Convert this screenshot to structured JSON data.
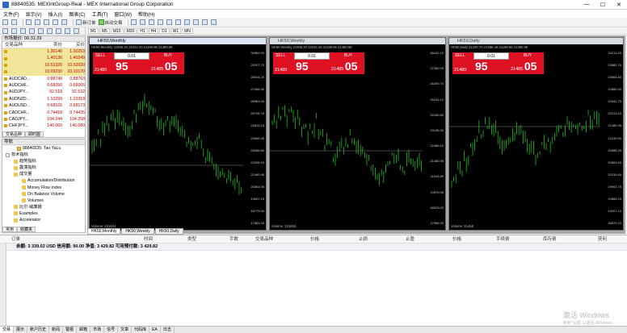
{
  "window": {
    "title": "88840535: MEXIntGroup-Real - MEX International Group Corporation",
    "min": "—",
    "max": "☐",
    "close": "✕"
  },
  "menu": [
    "文件(F)",
    "显示(V)",
    "插入(I)",
    "图表(C)",
    "工具(T)",
    "窗口(W)",
    "帮助(H)"
  ],
  "toolbar": {
    "new_order": "新订单",
    "auto_trade": "自动交易",
    "timeframes": [
      "M1",
      "M5",
      "M15",
      "M30",
      "H1",
      "H4",
      "D1",
      "W1",
      "MN"
    ]
  },
  "market_watch": {
    "header": "市场报价: 06:31:29",
    "cols": [
      "交易品种",
      "卖价",
      "买价"
    ],
    "rows": [
      {
        "sym": "",
        "bid": "1.30146",
        "ask": "1.30253",
        "hl": true
      },
      {
        "sym": "",
        "bid": "1.40136",
        "ask": "1.40249",
        "hl": true
      },
      {
        "sym": "",
        "bid": "10.51320",
        "ask": "10.52020",
        "hl": true
      },
      {
        "sym": "",
        "bid": "10.09230",
        "ask": "10.10170",
        "hl": true
      },
      {
        "sym": "AUDCAD...",
        "bid": "0.88748",
        "ask": "0.88763",
        "hl": false
      },
      {
        "sym": "AUDCHF...",
        "bid": "0.66050",
        "ask": "0.66065",
        "hl": false
      },
      {
        "sym": "AUDJPY...",
        "bid": "92.518",
        "ask": "92.532",
        "hl": false
      },
      {
        "sym": "AUDNZD...",
        "bid": "1.10299",
        "ask": "1.10318",
        "hl": false
      },
      {
        "sym": "AUDUSD...",
        "bid": "0.68165",
        "ask": "0.68173",
        "hl": false
      },
      {
        "sym": "CADCHF...",
        "bid": "0.74418",
        "ask": "0.74435",
        "hl": false
      },
      {
        "sym": "CADJPY...",
        "bid": "104.244",
        "ask": "104.258",
        "hl": false
      },
      {
        "sym": "CHFJPY...",
        "bid": "140.060",
        "ask": "140.080",
        "hl": false
      }
    ],
    "tabs": [
      "交易品种",
      "即时图"
    ]
  },
  "navigator": {
    "header": "导航",
    "items": [
      {
        "label": "88840535: Tao YaLu",
        "indent": 18,
        "kind": "pico"
      },
      {
        "label": "技术指标",
        "indent": 4,
        "kind": "box"
      },
      {
        "label": "趋势指标",
        "indent": 14,
        "kind": "fico"
      },
      {
        "label": "震荡指标",
        "indent": 14,
        "kind": "fico"
      },
      {
        "label": "成交量",
        "indent": 14,
        "kind": "fico"
      },
      {
        "label": "Accumulation/Distribution",
        "indent": 24,
        "kind": "fico"
      },
      {
        "label": "Money Flow Index",
        "indent": 24,
        "kind": "fico"
      },
      {
        "label": "On Balance Volume",
        "indent": 24,
        "kind": "fico"
      },
      {
        "label": "Volumes",
        "indent": 24,
        "kind": "fico"
      },
      {
        "label": "比尔·威廉姆",
        "indent": 14,
        "kind": "fico"
      },
      {
        "label": "Examples",
        "indent": 14,
        "kind": "fico"
      },
      {
        "label": "Accelerator",
        "indent": 14,
        "kind": "fico"
      }
    ],
    "tabs": [
      "常用",
      "收藏夹"
    ]
  },
  "charts": [
    {
      "id": "monthly",
      "title": "HK50,Monthly",
      "ohlc": "HK50,Monthly 21906.20 22224.40 21199.95 21480.95",
      "volume": "Volume: 231604",
      "sell_label": "SELL",
      "buy_label": "BUY",
      "lot": "0.01",
      "sell_px_small": "21480",
      "sell_px_big": "95",
      "buy_px_small": "21485",
      "buy_px_big": "05",
      "scale": [
        "30962.00",
        "29207.70",
        "28334.20",
        "27456.30",
        "26581.00",
        "25705.70",
        "24831.10",
        "23960.45",
        "23086.60",
        "22205.10",
        "21480.95",
        "20583.05",
        "19657.15",
        "18779.00",
        "17881.00"
      ],
      "current": "21480.95"
    },
    {
      "id": "weekly",
      "title": "HK50,Weekly",
      "ohlc": "HK50,Weekly 21906.20 22224.40 21199.95 21480.95",
      "volume": "Volume: 231653",
      "sell_label": "SELL",
      "buy_label": "BUY",
      "lot": "0.01",
      "sell_px_small": "21480",
      "sell_px_big": "95",
      "buy_px_small": "21485",
      "buy_px_big": "05",
      "scale": [
        "28442.10",
        "27350.05",
        "26299.70",
        "25244.10",
        "24180.60",
        "23135.30",
        "22486.10",
        "21480.95",
        "21043.85",
        "19970.95",
        "18923.20",
        "17968.20"
      ],
      "current": "21480.95"
    },
    {
      "id": "daily",
      "title": "HK50,Daily",
      "ohlc": "HK50,Daily 21430.70 21486.40 21199.95 21480.95",
      "volume": "Volume: 21458",
      "sell_label": "SELL",
      "buy_label": "BUY",
      "lot": "0.01",
      "sell_px_small": "21480",
      "sell_px_big": "95",
      "buy_px_small": "21485",
      "buy_px_big": "05",
      "scale": [
        "24213.20",
        "23882.75",
        "23564.80",
        "22880.20",
        "22542.75",
        "22213.10",
        "21480.95",
        "21240.90",
        "20898.25",
        "20563.50",
        "20234.60",
        "19903.75",
        "19585.15",
        "19207.10",
        "18870.10"
      ],
      "current": "21480.95"
    }
  ],
  "chart_tabs": [
    "HK50,Monthly",
    "HK50,Weekly",
    "HK50,Daily"
  ],
  "terminal": {
    "cols": [
      "订单",
      "时间",
      "类型",
      "手数",
      "交易品种",
      "价格",
      "止损",
      "止盈",
      "价格",
      "手续费",
      "库存费",
      "获利"
    ],
    "balance": "余额: 3 339.02 USD  信用额: 90.00  净值: 3 429.82  可用预付款: 3 429.82",
    "watermark_1": "激活 Windows",
    "watermark_2": "转到\"设置\"以激活 Windows。"
  },
  "bottom_tabs": [
    "交易",
    "展示",
    "账户历史",
    "新闻",
    "警报",
    "邮箱",
    "市场",
    "信号",
    "文章",
    "代码库",
    "EA",
    "日志"
  ]
}
